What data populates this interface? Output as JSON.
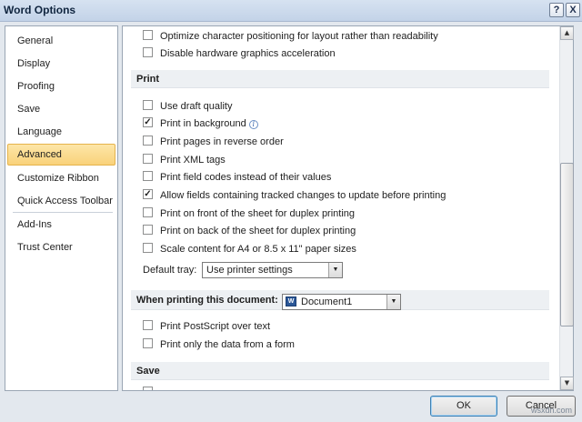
{
  "window": {
    "title": "Word Options",
    "help_glyph": "?",
    "close_glyph": "X"
  },
  "sidebar": {
    "items": [
      {
        "label": "General"
      },
      {
        "label": "Display"
      },
      {
        "label": "Proofing"
      },
      {
        "label": "Save"
      },
      {
        "label": "Language"
      },
      {
        "label": "Advanced",
        "selected": true
      },
      {
        "label": "Customize Ribbon"
      },
      {
        "label": "Quick Access Toolbar"
      },
      {
        "label": "Add-Ins"
      },
      {
        "label": "Trust Center"
      }
    ]
  },
  "display_section": {
    "options": [
      {
        "label": "Optimize character positioning for layout rather than readability",
        "checked": false
      },
      {
        "label": "Disable hardware graphics acceleration",
        "checked": false
      }
    ]
  },
  "print_section": {
    "heading": "Print",
    "options": [
      {
        "label": "Use draft quality",
        "checked": false
      },
      {
        "label": "Print in background",
        "checked": true,
        "info_icon": "info-icon"
      },
      {
        "label": "Print pages in reverse order",
        "checked": false
      },
      {
        "label": "Print XML tags",
        "checked": false
      },
      {
        "label": "Print field codes instead of their values",
        "checked": false
      },
      {
        "label": "Allow fields containing tracked changes to update before printing",
        "checked": true
      },
      {
        "label": "Print on front of the sheet for duplex printing",
        "checked": false
      },
      {
        "label": "Print on back of the sheet for duplex printing",
        "checked": false
      },
      {
        "label": "Scale content for A4 or 8.5 x 11\" paper sizes",
        "checked": false
      }
    ],
    "default_tray": {
      "label": "Default tray:",
      "value": "Use printer settings"
    },
    "info_glyph": "i"
  },
  "when_printing_section": {
    "heading": "When printing this document:",
    "document": "Document1",
    "doc_icon_glyph": "W",
    "options": [
      {
        "label": "Print PostScript over text",
        "checked": false
      },
      {
        "label": "Print only the data from a form",
        "checked": false
      }
    ]
  },
  "save_section": {
    "heading": "Save"
  },
  "buttons": {
    "ok": "OK",
    "cancel": "Cancel"
  },
  "dropdown_arrow_glyph": "▼",
  "scroll_up_glyph": "▲",
  "scroll_down_glyph": "▼",
  "watermark": "wsxdn.com"
}
